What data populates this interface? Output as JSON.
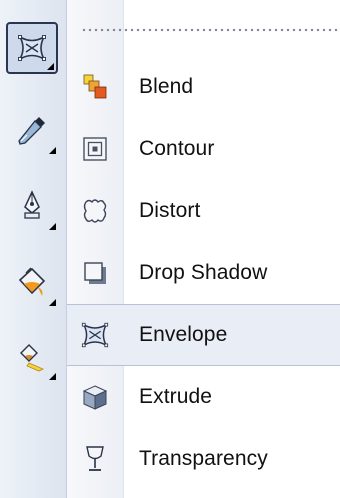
{
  "toolbox": {
    "tools": [
      {
        "name": "interactive-effects-tool",
        "icon": "envelope-icon",
        "active": true
      },
      {
        "name": "eyedropper-tool",
        "icon": "eyedropper-icon",
        "active": false
      },
      {
        "name": "outline-pen-tool",
        "icon": "pen-nib-icon",
        "active": false
      },
      {
        "name": "fill-tool",
        "icon": "paint-bucket-icon",
        "active": false
      },
      {
        "name": "interactive-fill-tool",
        "icon": "interactive-fill-icon",
        "active": false
      }
    ]
  },
  "menu": {
    "items": [
      {
        "label": "Blend",
        "icon": "blend-icon"
      },
      {
        "label": "Contour",
        "icon": "contour-icon"
      },
      {
        "label": "Distort",
        "icon": "distort-icon"
      },
      {
        "label": "Drop Shadow",
        "icon": "drop-shadow-icon"
      },
      {
        "label": "Envelope",
        "icon": "envelope-icon",
        "highlighted": true
      },
      {
        "label": "Extrude",
        "icon": "extrude-icon"
      },
      {
        "label": "Transparency",
        "icon": "transparency-icon"
      }
    ]
  },
  "colors": {
    "highlight_bg": "#e9edf6",
    "toolbox_bg": "#dde4ef",
    "accent_orange": "#f39a1e"
  }
}
